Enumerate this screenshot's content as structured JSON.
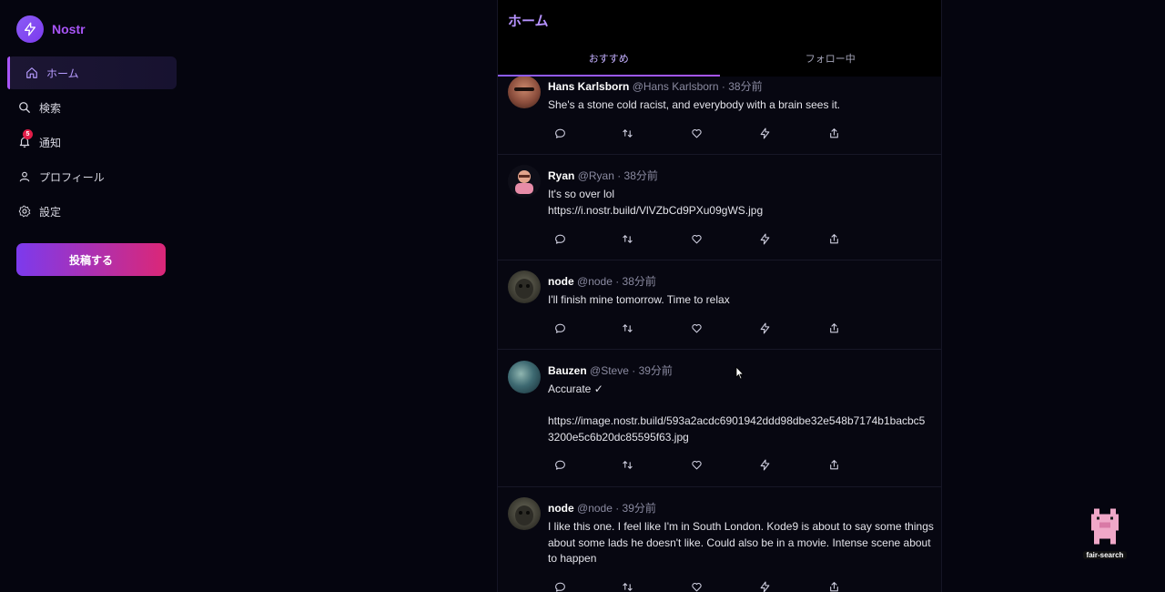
{
  "app": {
    "name": "Nostr"
  },
  "sidebar": {
    "items": [
      {
        "label": "ホーム",
        "icon": "home-icon",
        "active": true
      },
      {
        "label": "検索",
        "icon": "search-icon"
      },
      {
        "label": "通知",
        "icon": "bell-icon",
        "badge": "5"
      },
      {
        "label": "プロフィール",
        "icon": "user-icon"
      },
      {
        "label": "設定",
        "icon": "gear-icon"
      }
    ],
    "post_button": "投稿する"
  },
  "feed": {
    "title": "ホーム",
    "tabs": [
      {
        "label": "おすすめ",
        "active": true
      },
      {
        "label": "フォロー中",
        "active": false
      }
    ]
  },
  "posts": [
    {
      "name": "Hans Karlsborn",
      "meta": "@Hans Karlsborn · 38分前",
      "lines": [
        "She's a stone cold racist, and everybody with a brain sees it."
      ]
    },
    {
      "name": "Ryan",
      "meta": "@Ryan · 38分前",
      "lines": [
        "It's so over lol",
        "https://i.nostr.build/VlVZbCd9PXu09gWS.jpg"
      ]
    },
    {
      "name": "node",
      "meta": "@node · 38分前",
      "lines": [
        "I'll finish mine tomorrow. Time to relax"
      ]
    },
    {
      "name": "Bauzen",
      "meta": "@Steve · 39分前",
      "lines": [
        "Accurate ✓",
        "",
        "https://image.nostr.build/593a2acdc6901942ddd98dbe32e548b7174b1bacbc5",
        "3200e5c6b20dc85595f63.jpg"
      ]
    },
    {
      "name": "node",
      "meta": "@node · 39分前",
      "lines": [
        "I like this one. I feel like I'm in South London. Kode9 is about to say some things",
        "about some lads he doesn't like. Could also be in a movie. Intense scene about",
        "to happen"
      ]
    }
  ],
  "widget": {
    "label": "fair-search"
  },
  "colors": {
    "accent": "#a855f7",
    "button_start": "#7c3aed",
    "button_end": "#db2777",
    "background": "#05050f"
  }
}
